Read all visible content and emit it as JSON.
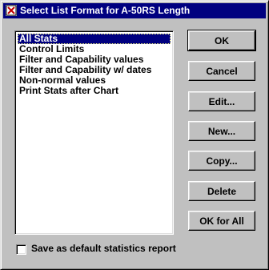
{
  "window": {
    "title": "Select List Format for A-50RS Length"
  },
  "list": {
    "items": [
      "All Stats",
      "Control Limits",
      "Filter and Capability values",
      "Filter and Capability w/ dates",
      "Non-normal values",
      "Print Stats after Chart"
    ],
    "selected_index": 0
  },
  "buttons": {
    "ok": "OK",
    "cancel": "Cancel",
    "edit": "Edit...",
    "new": "New...",
    "copy": "Copy...",
    "delete": "Delete",
    "ok_for_all": "OK for All"
  },
  "default_checkbox": {
    "label": "Save as default statistics report",
    "checked": false
  },
  "colors": {
    "title_bar": "#000080",
    "face": "#c0c0c0",
    "selection": "#000080"
  }
}
